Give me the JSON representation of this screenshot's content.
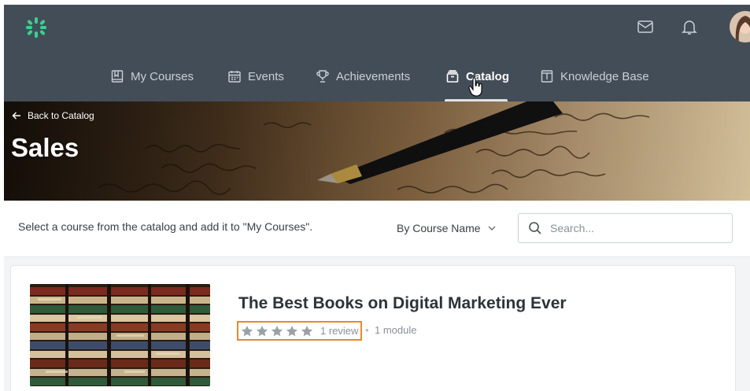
{
  "header": {
    "logo_text": "",
    "icons": [
      "mail-icon",
      "bell-icon"
    ],
    "colors": {
      "background": "#434d57",
      "logo": "#3ecf8e"
    }
  },
  "nav": {
    "items": [
      {
        "label": "My Courses",
        "icon": "book-icon",
        "active": false
      },
      {
        "label": "Events",
        "icon": "calendar-icon",
        "active": false
      },
      {
        "label": "Achievements",
        "icon": "trophy-icon",
        "active": false
      },
      {
        "label": "Catalog",
        "icon": "box-icon",
        "active": true
      },
      {
        "label": "Knowledge Base",
        "icon": "info-book-icon",
        "active": false
      }
    ]
  },
  "hero": {
    "back_label": "Back to Catalog",
    "title": "Sales"
  },
  "filter_bar": {
    "intro": "Select a course from the catalog and add it to \"My Courses\".",
    "sort": {
      "selected": "By Course Name"
    },
    "search": {
      "placeholder": "Search...",
      "value": ""
    }
  },
  "courses": [
    {
      "title": "The Best Books on Digital Marketing Ever",
      "rating": 5,
      "review_label": "1 review",
      "meta_separator": "•",
      "module_label": "1 module"
    }
  ],
  "colors": {
    "highlight": "#e8892b",
    "star": "#9aa0a6"
  }
}
